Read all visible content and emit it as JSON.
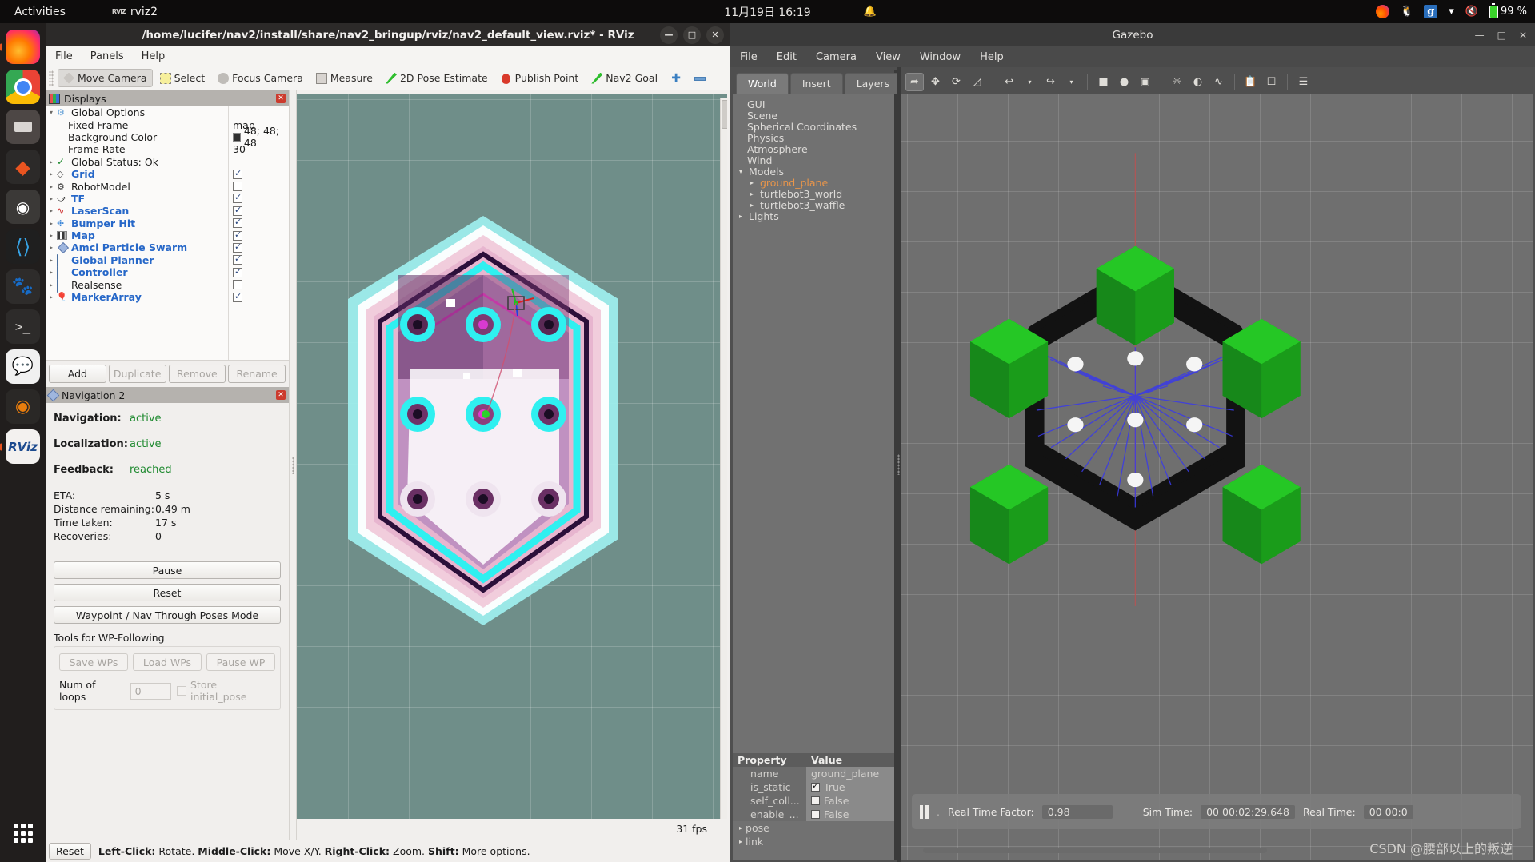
{
  "topbar": {
    "activities": "Activities",
    "app_icon": "rviz-icon",
    "app_name": "rviz2",
    "clock": "11月19日  16:19",
    "bell_icon": "bell-icon",
    "tray": {
      "firefox_icon": "firefox-icon",
      "penguin_icon": "penguin-icon",
      "g_icon": "g-icon",
      "wifi_icon": "wifi-icon",
      "volume_muted_icon": "volume-muted-icon",
      "battery_icon": "battery-charging-icon",
      "battery_label": "99 %"
    }
  },
  "dock": {
    "items": [
      {
        "name": "firefox",
        "glyph": ""
      },
      {
        "name": "chrome",
        "glyph": ""
      },
      {
        "name": "files",
        "glyph": ""
      },
      {
        "name": "ubuntu-software",
        "glyph": "◆"
      },
      {
        "name": "ubuntu-help",
        "glyph": "●"
      },
      {
        "name": "vscode",
        "glyph": "⬡"
      },
      {
        "name": "gimp",
        "glyph": "🦊"
      },
      {
        "name": "terminal",
        "glyph": ">_"
      },
      {
        "name": "wechat",
        "glyph": "💬"
      },
      {
        "name": "blender",
        "glyph": "◉"
      },
      {
        "name": "rviz",
        "glyph": "RViz"
      },
      {
        "name": "show-applications",
        "glyph": ""
      }
    ]
  },
  "rviz": {
    "title": "/home/lucifer/nav2/install/share/nav2_bringup/rviz/nav2_default_view.rviz* - RViz",
    "window_buttons": {
      "minimize": "—",
      "maximize": "□",
      "close": "✕"
    },
    "menu": [
      "File",
      "Panels",
      "Help"
    ],
    "toolbar": [
      {
        "label": "Move Camera",
        "icon": "move-camera-icon",
        "pressed": true
      },
      {
        "label": "Select",
        "icon": "select-icon",
        "pressed": false
      },
      {
        "label": "Focus Camera",
        "icon": "focus-camera-icon",
        "pressed": false
      },
      {
        "label": "Measure",
        "icon": "measure-icon",
        "pressed": false
      },
      {
        "label": "2D Pose Estimate",
        "icon": "pose-estimate-icon",
        "pressed": false
      },
      {
        "label": "Publish Point",
        "icon": "publish-point-icon",
        "pressed": false
      },
      {
        "label": "Nav2 Goal",
        "icon": "nav2-goal-icon",
        "pressed": false
      },
      {
        "label": "",
        "icon": "add-tool-icon",
        "pressed": false
      },
      {
        "label": "",
        "icon": "remove-tool-icon",
        "pressed": false
      }
    ],
    "displays_panel": {
      "title": "Displays",
      "icon": "displays-icon",
      "close_icon": "close-icon",
      "rows": [
        {
          "indent": 0,
          "arrow": "▾",
          "icon": "gear-icon",
          "label": "Global Options",
          "blue": false,
          "kind": "group"
        },
        {
          "indent": 1,
          "arrow": "",
          "icon": "",
          "label": "Fixed Frame",
          "blue": false,
          "kind": "value",
          "value": "map"
        },
        {
          "indent": 1,
          "arrow": "",
          "icon": "",
          "label": "Background Color",
          "blue": false,
          "kind": "color",
          "value": "48; 48; 48"
        },
        {
          "indent": 1,
          "arrow": "",
          "icon": "",
          "label": "Frame Rate",
          "blue": false,
          "kind": "value",
          "value": "30"
        },
        {
          "indent": 0,
          "arrow": "▸",
          "icon": "check-icon",
          "label": "Global Status: Ok",
          "blue": false,
          "kind": "status"
        },
        {
          "indent": 0,
          "arrow": "▸",
          "icon": "grid-icon",
          "label": "Grid",
          "blue": true,
          "kind": "check",
          "checked": true
        },
        {
          "indent": 0,
          "arrow": "▸",
          "icon": "robot-model-icon",
          "label": "RobotModel",
          "blue": false,
          "kind": "check",
          "checked": false
        },
        {
          "indent": 0,
          "arrow": "▸",
          "icon": "tf-icon",
          "label": "TF",
          "blue": true,
          "kind": "check",
          "checked": true
        },
        {
          "indent": 0,
          "arrow": "▸",
          "icon": "laser-scan-icon",
          "label": "LaserScan",
          "blue": true,
          "kind": "check",
          "checked": true
        },
        {
          "indent": 0,
          "arrow": "▸",
          "icon": "bumper-hit-icon",
          "label": "Bumper Hit",
          "blue": true,
          "kind": "check",
          "checked": true
        },
        {
          "indent": 0,
          "arrow": "▸",
          "icon": "map-icon",
          "label": "Map",
          "blue": true,
          "kind": "check",
          "checked": true
        },
        {
          "indent": 0,
          "arrow": "▸",
          "icon": "particle-icon",
          "label": "Amcl Particle Swarm",
          "blue": true,
          "kind": "check",
          "checked": true
        },
        {
          "indent": 0,
          "arrow": "▸",
          "icon": "folder-icon",
          "label": "Global Planner",
          "blue": true,
          "kind": "check",
          "checked": true
        },
        {
          "indent": 0,
          "arrow": "▸",
          "icon": "folder-icon",
          "label": "Controller",
          "blue": true,
          "kind": "check",
          "checked": true
        },
        {
          "indent": 0,
          "arrow": "▸",
          "icon": "folder-icon",
          "label": "Realsense",
          "blue": false,
          "kind": "check",
          "checked": false
        },
        {
          "indent": 0,
          "arrow": "▸",
          "icon": "marker-array-icon",
          "label": "MarkerArray",
          "blue": true,
          "kind": "check",
          "checked": true
        }
      ],
      "buttons": [
        {
          "label": "Add",
          "enabled": true
        },
        {
          "label": "Duplicate",
          "enabled": false
        },
        {
          "label": "Remove",
          "enabled": false
        },
        {
          "label": "Rename",
          "enabled": false
        }
      ]
    },
    "nav_panel": {
      "title": "Navigation 2",
      "icon": "navigation2-icon",
      "close_icon": "close-icon",
      "status": [
        {
          "key": "Navigation:",
          "value": "active"
        },
        {
          "key": "Localization:",
          "value": "active"
        },
        {
          "key": "Feedback:",
          "value": "reached"
        }
      ],
      "metrics": [
        {
          "key": "ETA:",
          "value": "5 s"
        },
        {
          "key": "Distance remaining:",
          "value": "0.49 m"
        },
        {
          "key": "Time taken:",
          "value": "17 s"
        },
        {
          "key": "Recoveries:",
          "value": "0"
        }
      ],
      "pause_button": "Pause",
      "reset_button": "Reset",
      "waypoint_button": "Waypoint / Nav Through Poses Mode",
      "tools_label": "Tools for WP-Following",
      "wp_buttons": [
        "Save WPs",
        "Load WPs",
        "Pause WP"
      ],
      "loops_label": "Num of loops",
      "loops_value": "0",
      "store_initial_label": "Store initial_pose"
    },
    "statusbar": {
      "reset_button": "Reset",
      "hint_parts": [
        {
          "bold": "Left-Click:",
          "text": " Rotate. "
        },
        {
          "bold": "Middle-Click:",
          "text": " Move X/Y. "
        },
        {
          "bold": "Right-Click:",
          "text": " Zoom. "
        },
        {
          "bold": "Shift:",
          "text": " More options."
        }
      ],
      "fps": "31 fps"
    }
  },
  "gazebo": {
    "title": "Gazebo",
    "window_buttons": {
      "minimize": "—",
      "maximize": "□",
      "close": "✕"
    },
    "menu": [
      "File",
      "Edit",
      "Camera",
      "View",
      "Window",
      "Help"
    ],
    "tabs": [
      {
        "label": "World",
        "active": true
      },
      {
        "label": "Insert",
        "active": false
      },
      {
        "label": "Layers",
        "active": false
      }
    ],
    "tree": [
      {
        "indent": 1,
        "arrow": "",
        "label": "GUI",
        "selected": false
      },
      {
        "indent": 1,
        "arrow": "",
        "label": "Scene",
        "selected": false
      },
      {
        "indent": 1,
        "arrow": "",
        "label": "Spherical Coordinates",
        "selected": false
      },
      {
        "indent": 1,
        "arrow": "",
        "label": "Physics",
        "selected": false
      },
      {
        "indent": 1,
        "arrow": "",
        "label": "Atmosphere",
        "selected": false
      },
      {
        "indent": 1,
        "arrow": "",
        "label": "Wind",
        "selected": false
      },
      {
        "indent": 0,
        "arrow": "▾",
        "label": "Models",
        "selected": false
      },
      {
        "indent": 2,
        "arrow": "▸",
        "label": "ground_plane",
        "selected": true
      },
      {
        "indent": 2,
        "arrow": "▸",
        "label": "turtlebot3_world",
        "selected": false
      },
      {
        "indent": 2,
        "arrow": "▸",
        "label": "turtlebot3_waffle",
        "selected": false
      },
      {
        "indent": 0,
        "arrow": "▸",
        "label": "Lights",
        "selected": false
      }
    ],
    "property_headers": [
      "Property",
      "Value"
    ],
    "properties": [
      {
        "name": "name",
        "value": "ground_plane",
        "type": "text"
      },
      {
        "name": "is_static",
        "value": "True",
        "type": "check",
        "checked": true
      },
      {
        "name": "self_coll...",
        "value": "False",
        "type": "check",
        "checked": false
      },
      {
        "name": "enable_...",
        "value": "False",
        "type": "check",
        "checked": false
      },
      {
        "name": "pose",
        "value": "",
        "type": "expand",
        "arrow": "▸"
      },
      {
        "name": "link",
        "value": "",
        "type": "expand",
        "arrow": "▸"
      }
    ],
    "toolbar_icons": [
      "select-mode-icon",
      "translate-mode-icon",
      "rotate-mode-icon",
      "scale-mode-icon",
      "undo-icon",
      "undo-dropdown-icon",
      "redo-icon",
      "redo-dropdown-icon",
      "box-icon",
      "sphere-icon",
      "cylinder-icon",
      "point-light-icon",
      "spot-light-icon",
      "directional-light-icon",
      "copy-icon",
      "paste-icon",
      "align-icon"
    ],
    "status": {
      "pause_icon": "pause-icon",
      "rtf_label": "Real Time Factor:",
      "rtf_value": "0.98",
      "sim_time_label": "Sim Time:",
      "sim_time_value": "00 00:02:29.648",
      "real_time_label": "Real Time:",
      "real_time_value": "00 00:0"
    }
  },
  "watermark": "CSDN @腰部以上的叛逆"
}
